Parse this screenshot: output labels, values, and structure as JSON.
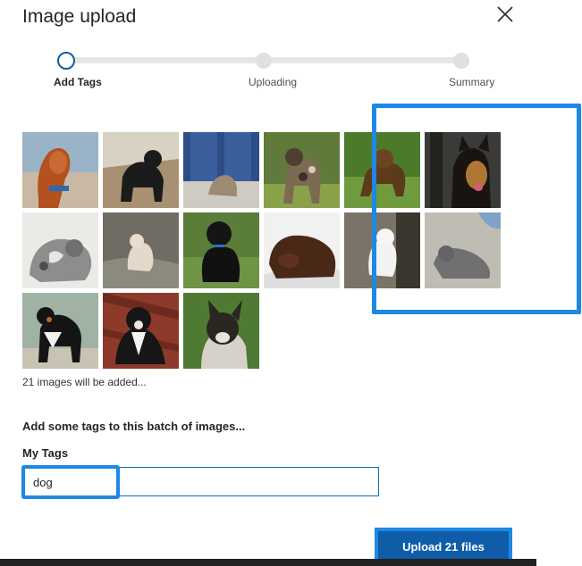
{
  "dialog": {
    "title": "Image upload",
    "close_icon": "close-icon"
  },
  "stepper": {
    "steps": [
      {
        "label": "Add Tags",
        "state": "active"
      },
      {
        "label": "Uploading",
        "state": "inactive"
      },
      {
        "label": "Summary",
        "state": "inactive"
      }
    ]
  },
  "gallery": {
    "images": [
      "Red setter dog on beach",
      "Black dog on rocky beach",
      "Dog by blue door",
      "Spotted wild dog",
      "Brown dog on grass",
      "German shepherd dog",
      "Grey spotted dog lying down",
      "White dog in water",
      "Black poodle on grass",
      "Brown labrador lying down",
      "Small white dog",
      "Grey dog lying on ground",
      "Bernese mountain dog",
      "Tricolor dog lying on deck",
      "Cattle dog with ears up"
    ],
    "count_text": "21 images will be added..."
  },
  "tags": {
    "heading": "Add some tags to this batch of images...",
    "field_label": "My Tags",
    "current_tag": "dog"
  },
  "actions": {
    "upload_label": "Upload 21 files"
  },
  "colors": {
    "accent": "#0f5da8",
    "highlight": "#1e88e5",
    "track": "#e6e6e6"
  }
}
